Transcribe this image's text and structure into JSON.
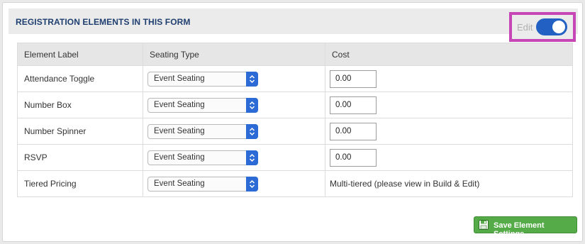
{
  "header": {
    "title": "REGISTRATION ELEMENTS IN THIS FORM",
    "edit_label": "Edit",
    "edit_toggle_on": true
  },
  "table": {
    "columns": [
      "Element Label",
      "Seating Type",
      "Cost"
    ],
    "rows": [
      {
        "label": "Attendance Toggle",
        "seating": "Event Seating",
        "cost": "0.00",
        "cost_is_input": true
      },
      {
        "label": "Number Box",
        "seating": "Event Seating",
        "cost": "0.00",
        "cost_is_input": true
      },
      {
        "label": "Number Spinner",
        "seating": "Event Seating",
        "cost": "0.00",
        "cost_is_input": true
      },
      {
        "label": "RSVP",
        "seating": "Event Seating",
        "cost": "0.00",
        "cost_is_input": true
      },
      {
        "label": "Tiered Pricing",
        "seating": "Event Seating",
        "cost": "Multi-tiered (please view in Build & Edit)",
        "cost_is_input": false
      }
    ]
  },
  "footer": {
    "save_label": "Save Element Settings"
  },
  "colors": {
    "header_title": "#1f3f70",
    "toggle": "#2260c4",
    "highlight_border": "#c546b4",
    "save_button": "#54ab47"
  },
  "icons": {
    "select_arrows": "chevron-updown-icon",
    "save": "floppy-disk-icon"
  }
}
